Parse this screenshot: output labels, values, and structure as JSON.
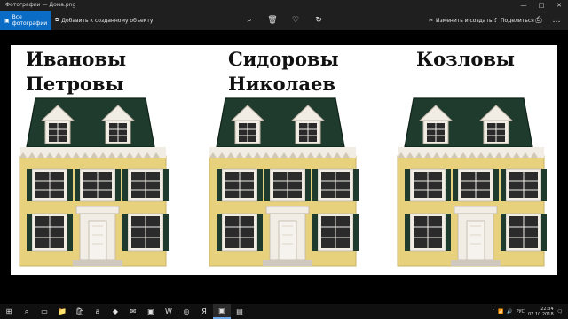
{
  "window": {
    "title": "Фотографии — Дома.png"
  },
  "toolbar": {
    "all_photos": "Все фотографии",
    "add_to_creation": "Добавить к созданному объекту",
    "edit_create": "Изменить и создать",
    "share": "Поделиться"
  },
  "image": {
    "labels": {
      "left": "Ивановы\nПетровы",
      "center": "Сидоровы\nНиколаев",
      "right": "Козловы"
    }
  },
  "taskbar": {
    "lang": "РУС",
    "time": "22:34",
    "date": "07.10.2018"
  },
  "colors": {
    "accent": "#0b6cc6",
    "roof": "#1e3b2e",
    "house_wall": "#e8d17c",
    "shutters": "#1f3b2e",
    "trim": "#f1ede5"
  }
}
